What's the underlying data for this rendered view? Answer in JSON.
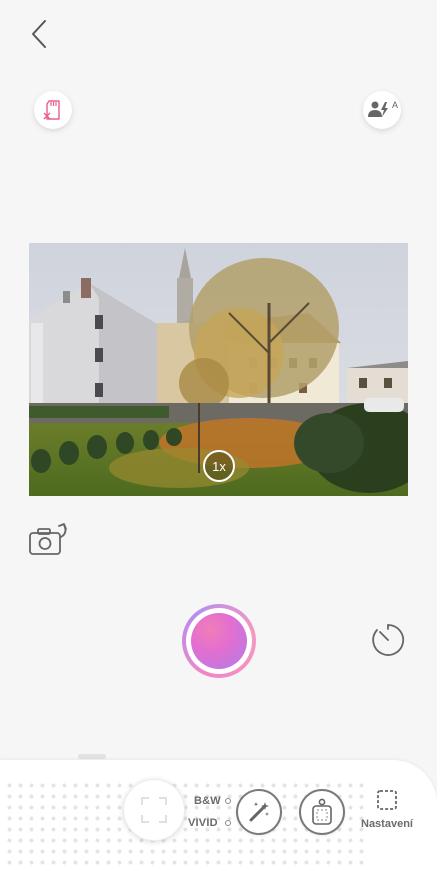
{
  "header": {
    "back_icon": "chevron-left-icon"
  },
  "top_controls": {
    "sd_card_icon": "sd-card-error-icon",
    "flash_icon": "auto-flash-icon",
    "flash_mode_badge": "A"
  },
  "preview": {
    "zoom_label": "1x"
  },
  "camera_controls": {
    "flip_icon": "camera-switch-icon",
    "shutter_icon": "shutter-button",
    "timer_icon": "timer-icon"
  },
  "tray": {
    "focus_icon": "focus-frame-icon",
    "mode_bw": "B&W",
    "mode_vivid": "VIVID",
    "magic_icon": "magic-wand-icon",
    "frame_icon": "frame-icon",
    "settings_label": "Nastavení"
  },
  "colors": {
    "accent_pink": "#f27db8",
    "accent_purple": "#b07be9",
    "sd_icon_pink": "#e85d8f"
  }
}
